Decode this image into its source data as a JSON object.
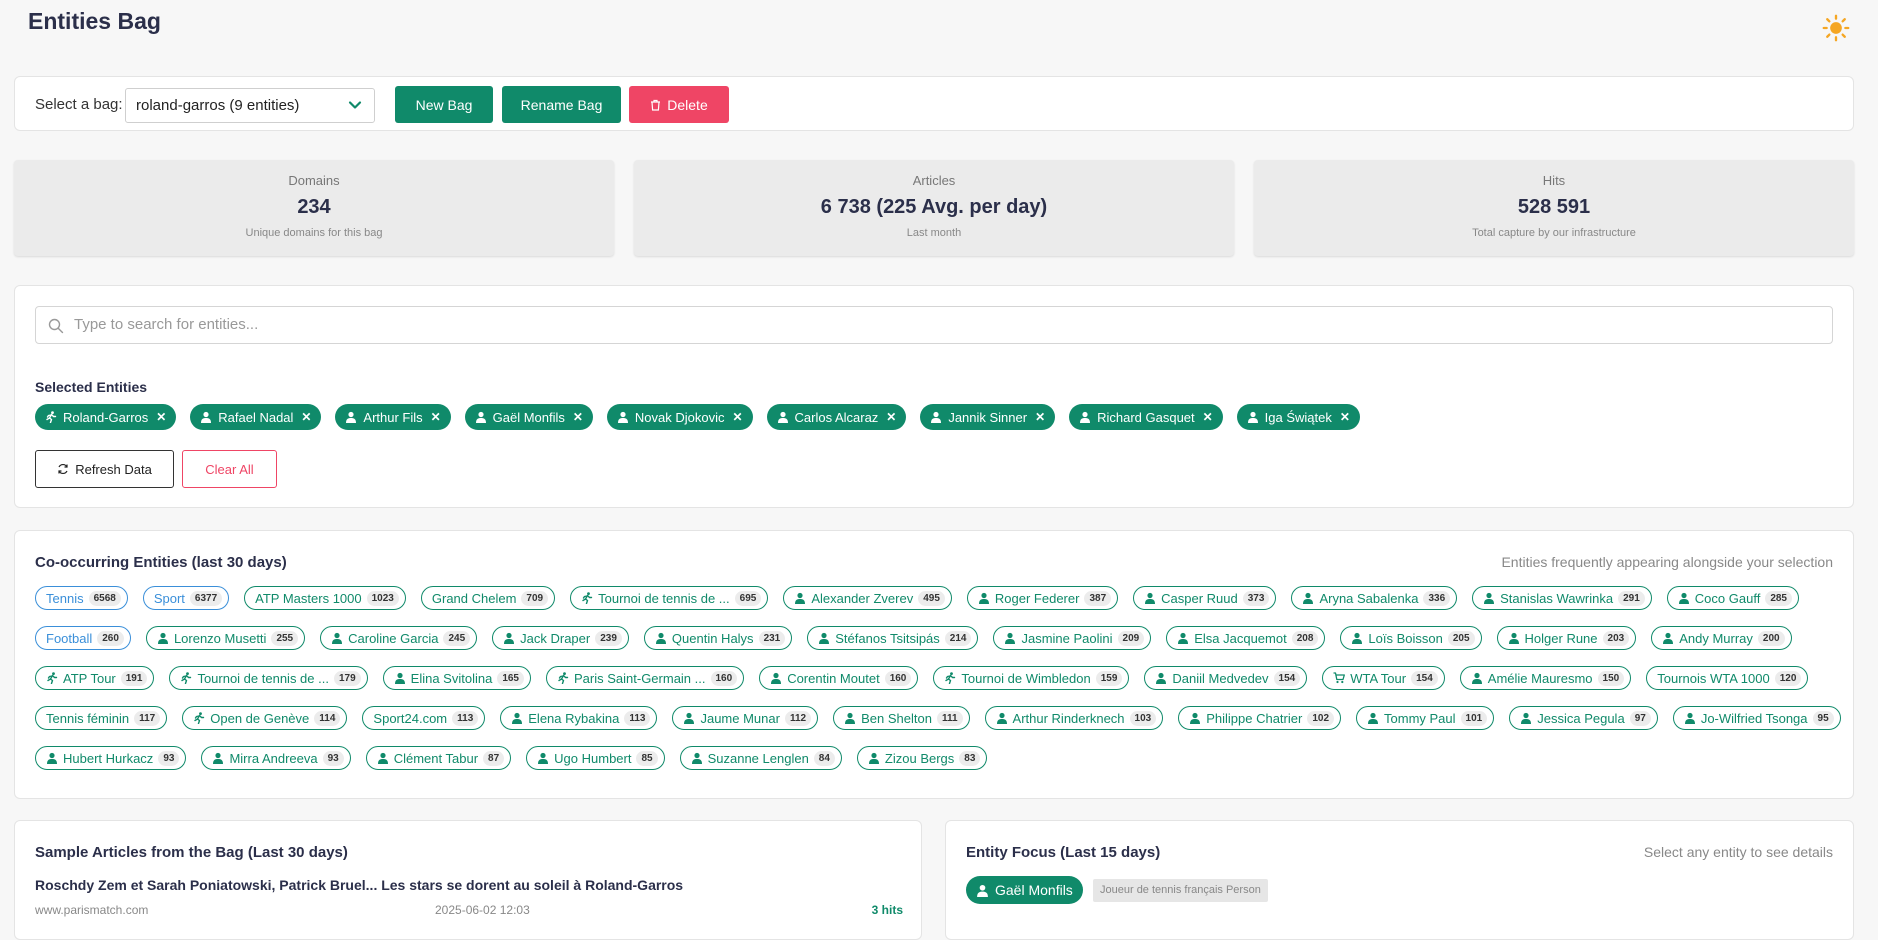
{
  "header": {
    "title": "Entities Bag",
    "theme_icon": "sun-icon"
  },
  "bag": {
    "label": "Select a bag:",
    "selected": "roland-garros (9 entities)",
    "new_label": "New Bag",
    "rename_label": "Rename Bag",
    "delete_label": "Delete"
  },
  "stats": [
    {
      "label": "Domains",
      "value": "234",
      "sub": "Unique domains for this bag"
    },
    {
      "label": "Articles",
      "value": "6 738 (225 Avg. per day)",
      "sub": "Last month"
    },
    {
      "label": "Hits",
      "value": "528 591",
      "sub": "Total capture by our infrastructure"
    }
  ],
  "search": {
    "placeholder": "Type to search for entities..."
  },
  "selected": {
    "title": "Selected Entities",
    "items": [
      {
        "label": "Roland-Garros",
        "icon": "runner-icon"
      },
      {
        "label": "Rafael Nadal",
        "icon": "person-icon"
      },
      {
        "label": "Arthur Fils",
        "icon": "person-icon"
      },
      {
        "label": "Gaël Monfils",
        "icon": "person-icon"
      },
      {
        "label": "Novak Djokovic",
        "icon": "person-icon"
      },
      {
        "label": "Carlos Alcaraz",
        "icon": "person-icon"
      },
      {
        "label": "Jannik Sinner",
        "icon": "person-icon"
      },
      {
        "label": "Richard Gasquet",
        "icon": "person-icon"
      },
      {
        "label": "Iga Świątek",
        "icon": "person-icon"
      }
    ],
    "refresh_label": "Refresh Data",
    "clear_label": "Clear All"
  },
  "cooccur": {
    "title": "Co-occurring Entities (last 30 days)",
    "hint": "Entities frequently appearing alongside your selection",
    "items": [
      {
        "label": "Tennis",
        "count": "6568",
        "icon": "",
        "color": "blue"
      },
      {
        "label": "Sport",
        "count": "6377",
        "icon": "",
        "color": "blue"
      },
      {
        "label": "ATP Masters 1000",
        "count": "1023",
        "icon": "",
        "color": "green"
      },
      {
        "label": "Grand Chelem",
        "count": "709",
        "icon": "",
        "color": "green"
      },
      {
        "label": "Tournoi de tennis de ...",
        "count": "695",
        "icon": "runner-icon",
        "color": "green"
      },
      {
        "label": "Alexander Zverev",
        "count": "495",
        "icon": "person-icon",
        "color": "green"
      },
      {
        "label": "Roger Federer",
        "count": "387",
        "icon": "person-icon",
        "color": "green"
      },
      {
        "label": "Casper Ruud",
        "count": "373",
        "icon": "person-icon",
        "color": "green"
      },
      {
        "label": "Aryna Sabalenka",
        "count": "336",
        "icon": "person-icon",
        "color": "green"
      },
      {
        "label": "Stanislas Wawrinka",
        "count": "291",
        "icon": "person-icon",
        "color": "green"
      },
      {
        "label": "Coco Gauff",
        "count": "285",
        "icon": "person-icon",
        "color": "green"
      },
      {
        "label": "Football",
        "count": "260",
        "icon": "",
        "color": "blue"
      },
      {
        "label": "Lorenzo Musetti",
        "count": "255",
        "icon": "person-icon",
        "color": "green"
      },
      {
        "label": "Caroline Garcia",
        "count": "245",
        "icon": "person-icon",
        "color": "green"
      },
      {
        "label": "Jack Draper",
        "count": "239",
        "icon": "person-icon",
        "color": "green"
      },
      {
        "label": "Quentin Halys",
        "count": "231",
        "icon": "person-icon",
        "color": "green"
      },
      {
        "label": "Stéfanos Tsitsipás",
        "count": "214",
        "icon": "person-icon",
        "color": "green"
      },
      {
        "label": "Jasmine Paolini",
        "count": "209",
        "icon": "person-icon",
        "color": "green"
      },
      {
        "label": "Elsa Jacquemot",
        "count": "208",
        "icon": "person-icon",
        "color": "green"
      },
      {
        "label": "Loïs Boisson",
        "count": "205",
        "icon": "person-icon",
        "color": "green"
      },
      {
        "label": "Holger Rune",
        "count": "203",
        "icon": "person-icon",
        "color": "green"
      },
      {
        "label": "Andy Murray",
        "count": "200",
        "icon": "person-icon",
        "color": "green"
      },
      {
        "label": "ATP Tour",
        "count": "191",
        "icon": "runner-icon",
        "color": "green"
      },
      {
        "label": "Tournoi de tennis de ...",
        "count": "179",
        "icon": "runner-icon",
        "color": "green"
      },
      {
        "label": "Elina Svitolina",
        "count": "165",
        "icon": "person-icon",
        "color": "green"
      },
      {
        "label": "Paris Saint-Germain ...",
        "count": "160",
        "icon": "runner-icon",
        "color": "green"
      },
      {
        "label": "Corentin Moutet",
        "count": "160",
        "icon": "person-icon",
        "color": "green"
      },
      {
        "label": "Tournoi de Wimbledon",
        "count": "159",
        "icon": "runner-icon",
        "color": "green"
      },
      {
        "label": "Daniil Medvedev",
        "count": "154",
        "icon": "person-icon",
        "color": "green"
      },
      {
        "label": "WTA Tour",
        "count": "154",
        "icon": "cart-icon",
        "color": "green"
      },
      {
        "label": "Amélie Mauresmo",
        "count": "150",
        "icon": "person-icon",
        "color": "green"
      },
      {
        "label": "Tournois WTA 1000",
        "count": "120",
        "icon": "",
        "color": "green"
      },
      {
        "label": "Tennis féminin",
        "count": "117",
        "icon": "",
        "color": "green"
      },
      {
        "label": "Open de Genève",
        "count": "114",
        "icon": "runner-icon",
        "color": "green"
      },
      {
        "label": "Sport24.com",
        "count": "113",
        "icon": "",
        "color": "green"
      },
      {
        "label": "Elena Rybakina",
        "count": "113",
        "icon": "person-icon",
        "color": "green"
      },
      {
        "label": "Jaume Munar",
        "count": "112",
        "icon": "person-icon",
        "color": "green"
      },
      {
        "label": "Ben Shelton",
        "count": "111",
        "icon": "person-icon",
        "color": "green"
      },
      {
        "label": "Arthur Rinderknech",
        "count": "103",
        "icon": "person-icon",
        "color": "green"
      },
      {
        "label": "Philippe Chatrier",
        "count": "102",
        "icon": "person-icon",
        "color": "green"
      },
      {
        "label": "Tommy Paul",
        "count": "101",
        "icon": "person-icon",
        "color": "green"
      },
      {
        "label": "Jessica Pegula",
        "count": "97",
        "icon": "person-icon",
        "color": "green"
      },
      {
        "label": "Jo-Wilfried Tsonga",
        "count": "95",
        "icon": "person-icon",
        "color": "green"
      },
      {
        "label": "Hubert Hurkacz",
        "count": "93",
        "icon": "person-icon",
        "color": "green"
      },
      {
        "label": "Mirra Andreeva",
        "count": "93",
        "icon": "person-icon",
        "color": "green"
      },
      {
        "label": "Clément Tabur",
        "count": "87",
        "icon": "person-icon",
        "color": "green"
      },
      {
        "label": "Ugo Humbert",
        "count": "85",
        "icon": "person-icon",
        "color": "green"
      },
      {
        "label": "Suzanne Lenglen",
        "count": "84",
        "icon": "person-icon",
        "color": "green"
      },
      {
        "label": "Zizou Bergs",
        "count": "83",
        "icon": "person-icon",
        "color": "green"
      }
    ]
  },
  "articles": {
    "title": "Sample Articles from the Bag (Last 30 days)",
    "first_title": "Roschdy Zem et Sarah Poniatowski, Patrick Bruel... Les stars se dorent au soleil à Roland-Garros",
    "first_source": "www.parismatch.com",
    "first_date": "2025-06-02 12:03",
    "first_hits": "3 hits"
  },
  "focus": {
    "title": "Entity Focus (Last 15 days)",
    "hint": "Select any entity to see details",
    "entity": "Gaël Monfils",
    "desc": "Joueur de tennis français Person"
  },
  "colors": {
    "green": "#108a6a",
    "red": "#ef4565",
    "blue": "#3a8fd9",
    "sun": "#f5a623"
  }
}
